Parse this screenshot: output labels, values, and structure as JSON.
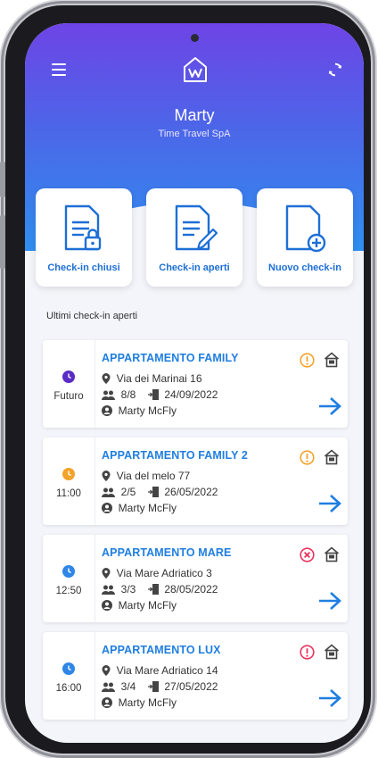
{
  "header": {
    "user_name": "Marty",
    "company": "Time Travel SpA"
  },
  "cards": [
    {
      "label": "Check-in chiusi",
      "icon": "doc-lock-icon"
    },
    {
      "label": "Check-in aperti",
      "icon": "doc-edit-icon"
    },
    {
      "label": "Nuovo check-in",
      "icon": "doc-add-icon"
    }
  ],
  "section_title": "Ultimi check-in aperti",
  "colors": {
    "accent_blue": "#1f7ee0",
    "purple": "#5b2bc6",
    "orange": "#f2a32a",
    "warning_orange": "#f2a32a",
    "error_red": "#e8335f"
  },
  "items": [
    {
      "time": "Futuro",
      "clock_color": "#5b2bc6",
      "title": "APPARTAMENTO FAMILY",
      "address": "Via dei Marinai 16",
      "guests": "8/8",
      "date": "24/09/2022",
      "person": "Marty McFly",
      "status": "warning"
    },
    {
      "time": "11:00",
      "clock_color": "#f2a32a",
      "title": "APPARTAMENTO FAMILY 2",
      "address": "Via del melo 77",
      "guests": "2/5",
      "date": "26/05/2022",
      "person": "Marty McFly",
      "status": "warning"
    },
    {
      "time": "12:50",
      "clock_color": "#2f86e6",
      "title": "APPARTAMENTO MARE",
      "address": "Via Mare Adriatico 3",
      "guests": "3/3",
      "date": "28/05/2022",
      "person": "Marty McFly",
      "status": "error"
    },
    {
      "time": "16:00",
      "clock_color": "#2f86e6",
      "title": "APPARTAMENTO LUX",
      "address": "Via Mare Adriatico 14",
      "guests": "3/4",
      "date": "27/05/2022",
      "person": "Marty McFly",
      "status": "error-alert"
    }
  ]
}
